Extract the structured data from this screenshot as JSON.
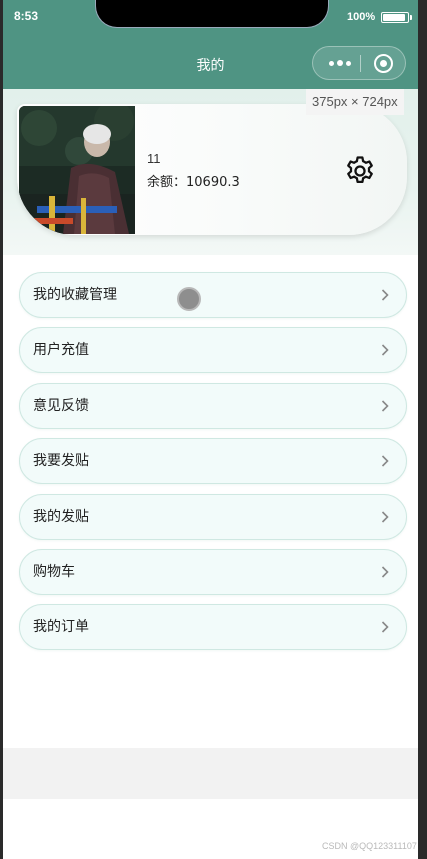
{
  "status_bar": {
    "time": "8:53",
    "battery": "100%"
  },
  "nav": {
    "title": "我的"
  },
  "overlay": {
    "size_text": "375px × 724px"
  },
  "profile": {
    "username": "11",
    "balance_text": "余额：10690.3"
  },
  "menu": {
    "items": [
      {
        "label": "我的收藏管理"
      },
      {
        "label": "用户充值"
      },
      {
        "label": "意见反馈"
      },
      {
        "label": "我要发贴"
      },
      {
        "label": "我的发贴"
      },
      {
        "label": "购物车"
      },
      {
        "label": "我的订单"
      }
    ]
  },
  "watermark": "CSDN @QQ123311107",
  "colors": {
    "theme": "#4f9483",
    "menu_border": "#cfe8e2",
    "menu_bg": "#f2fbfa"
  },
  "icons": {
    "settings": "gear-icon",
    "arrow": "chevron-right-icon",
    "capsule_more": "more-dots-icon",
    "capsule_close": "target-icon"
  }
}
